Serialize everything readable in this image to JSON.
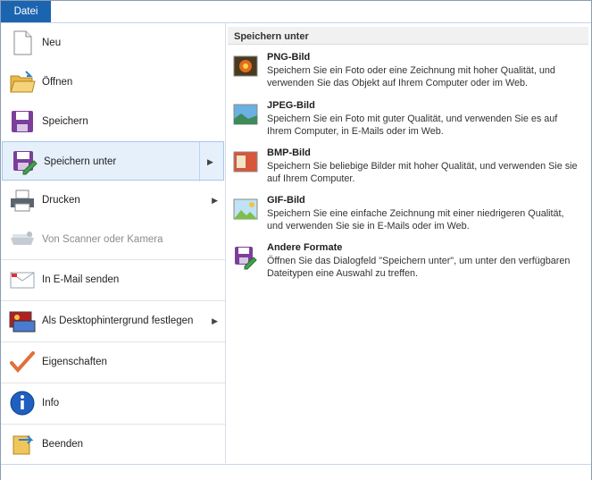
{
  "tab": {
    "label": "Datei"
  },
  "menu": [
    {
      "name": "new",
      "label": "Neu",
      "icon": "new-file-icon"
    },
    {
      "name": "open",
      "label": "Öffnen",
      "icon": "folder-open-icon"
    },
    {
      "name": "save",
      "label": "Speichern",
      "icon": "floppy-disk-icon"
    },
    {
      "name": "save-as",
      "label": "Speichern unter",
      "icon": "save-as-icon",
      "submenu": true,
      "active": true
    },
    {
      "name": "print",
      "label": "Drucken",
      "icon": "printer-icon",
      "submenu": true
    },
    {
      "name": "scanner",
      "label": "Von Scanner oder Kamera",
      "icon": "scanner-icon",
      "disabled": true
    },
    {
      "name": "email",
      "label": "In E-Mail senden",
      "icon": "email-icon"
    },
    {
      "name": "desktop-bg",
      "label": "Als Desktophintergrund festlegen",
      "icon": "desktop-background-icon",
      "submenu": true
    },
    {
      "name": "properties",
      "label": "Eigenschaften",
      "icon": "checkmark-icon"
    },
    {
      "name": "info",
      "label": "Info",
      "icon": "info-icon"
    },
    {
      "name": "exit",
      "label": "Beenden",
      "icon": "exit-icon"
    }
  ],
  "panel": {
    "title": "Speichern unter",
    "options": [
      {
        "title": "PNG-Bild",
        "desc": "Speichern Sie ein Foto oder eine Zeichnung mit hoher Qualität, und verwenden Sie das Objekt auf Ihrem Computer oder im Web.",
        "icon": "png-image-icon"
      },
      {
        "title": "JPEG-Bild",
        "desc": "Speichern Sie ein Foto mit guter Qualität, und verwenden Sie es auf Ihrem Computer, in E-Mails oder im Web.",
        "icon": "jpeg-image-icon"
      },
      {
        "title": "BMP-Bild",
        "desc": "Speichern Sie beliebige Bilder mit hoher Qualität, und verwenden Sie sie auf Ihrem Computer.",
        "icon": "bmp-image-icon"
      },
      {
        "title": "GIF-Bild",
        "desc": "Speichern Sie eine einfache Zeichnung mit einer niedrigeren Qualität, und verwenden Sie sie in E-Mails oder im Web.",
        "icon": "gif-image-icon"
      },
      {
        "title": "Andere Formate",
        "desc": "Öffnen Sie das Dialogfeld \"Speichern unter\", um unter den verfügbaren Dateitypen eine Auswahl zu treffen.",
        "icon": "other-formats-icon"
      }
    ]
  },
  "colors": {
    "accent": "#1b64b0",
    "highlight": "#e5f0fb"
  }
}
